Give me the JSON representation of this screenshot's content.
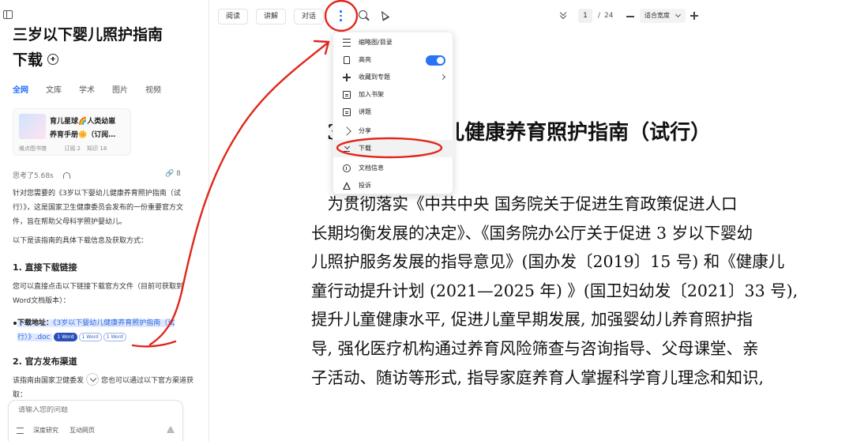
{
  "chat": {
    "title_line1": "三岁以下婴儿照护指南",
    "title_line2": "下载",
    "tabs": [
      {
        "label": "全网",
        "active": true
      },
      {
        "label": "文库",
        "active": false
      },
      {
        "label": "学术",
        "active": false
      },
      {
        "label": "图片",
        "active": false
      },
      {
        "label": "视频",
        "active": false
      }
    ],
    "card": {
      "line1": "育儿星球🌈人类幼崽",
      "line2": "养育手册🌼（订阅…",
      "source": "维点图书馆",
      "subs": "订阅 2",
      "knowledge": "知识 18"
    },
    "think_time": "思考了5.68s",
    "link_count": "🔗 8",
    "intro": "针对您需要的《3岁以下婴幼儿健康养育照护指南（试行）》，这是国家卫生健康委员会发布的一份重要官方文件，旨在帮助父母科学照护婴幼儿。",
    "intro2": "以下是该指南的具体下载信息及获取方式：",
    "section1": "1. 直接下载链接",
    "section1_text": "您可以直接点击以下链接下载官方文件（目前可获取到Word文档版本）：",
    "download_label": "下载地址：",
    "download_link": "《3岁以下婴幼儿健康养育照护指南（试行）》.doc",
    "word_tags": [
      "1 Word",
      "1 Word",
      "1 Word"
    ],
    "section2": "2. 官方发布渠道",
    "section2_text_a": "该指南由国家卫健委发",
    "section2_text_b": "您也可以通过以下官方渠道获取：",
    "input_placeholder": "请输入您的问题",
    "tool_deep": "深度研究",
    "tool_web": "互动网页"
  },
  "viewer": {
    "btn_read": "阅读",
    "btn_explain": "讲解",
    "btn_chat": "对话",
    "page_current": "1",
    "page_sep": "/",
    "page_total": "24",
    "zoom_label": "适合宽度",
    "doc_title": "3岁以下婴幼儿健康养育照护指南（试行）",
    "doc_lines": [
      "　为贯彻落实《中共中央 国务院关于促进生育政策促进人口",
      "长期均衡发展的决定》、《国务院办公厅关于促进 3 岁以下婴幼",
      "儿照护服务发展的指导意见》(国办发〔2019〕15 号) 和《健康儿",
      "童行动提升计划 (2021—2025 年) 》(国卫妇幼发〔2021〕33 号),",
      "提升儿童健康水平, 促进儿童早期发展, 加强婴幼儿养育照护指",
      "导, 强化医疗机构通过养育风险筛查与咨询指导、父母课堂、亲",
      "子活动、随访等形式, 指导家庭养育人掌握科学育儿理念和知识,"
    ]
  },
  "menu": {
    "items": [
      {
        "label": "缩略图/目录",
        "icon": "list-icon"
      },
      {
        "label": "高亮",
        "icon": "highlighter-icon",
        "toggle_on": true
      },
      {
        "label": "收藏到专题",
        "icon": "plus-icon",
        "submenu": true
      },
      {
        "label": "加入书架",
        "icon": "bookshelf-icon"
      },
      {
        "label": "讲题",
        "icon": "document-icon"
      },
      {
        "label": "分享",
        "icon": "share-icon"
      },
      {
        "label": "下载",
        "icon": "download-icon",
        "hover": true
      },
      {
        "label": "文档信息",
        "icon": "info-icon"
      },
      {
        "label": "投诉",
        "icon": "warning-icon"
      }
    ]
  },
  "colors": {
    "accent": "#1f6fff",
    "annotation": "#e0261b",
    "toggle": "#2a73f5"
  }
}
